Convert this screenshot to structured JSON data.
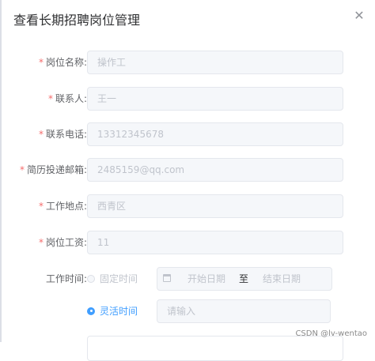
{
  "dialog": {
    "title": "查看长期招聘岗位管理",
    "close_icon": "close-icon"
  },
  "form": {
    "fields": [
      {
        "label": "岗位名称:",
        "value": "操作工",
        "required": true
      },
      {
        "label": "联系人:",
        "value": "王一",
        "required": true
      },
      {
        "label": "联系电话:",
        "value": "13312345678",
        "required": true
      },
      {
        "label": "简历投递邮箱:",
        "value": "2485159@qq.com",
        "required": true
      },
      {
        "label": "工作地点:",
        "value": "西青区",
        "required": true
      },
      {
        "label": "岗位工资:",
        "value": "11",
        "required": true
      }
    ],
    "work_time": {
      "label": "工作时间:",
      "fixed_option": "固定时间",
      "range_start_placeholder": "开始日期",
      "range_separator": "至",
      "range_end_placeholder": "结束日期",
      "flexible_option": "灵活时间",
      "flexible_placeholder": "请输入",
      "selected": "灵活时间"
    }
  },
  "watermark": "CSDN @lv-wentao",
  "colors": {
    "required": "#f56c6c",
    "accent": "#409eff",
    "disabled_bg": "#f5f7fa"
  }
}
